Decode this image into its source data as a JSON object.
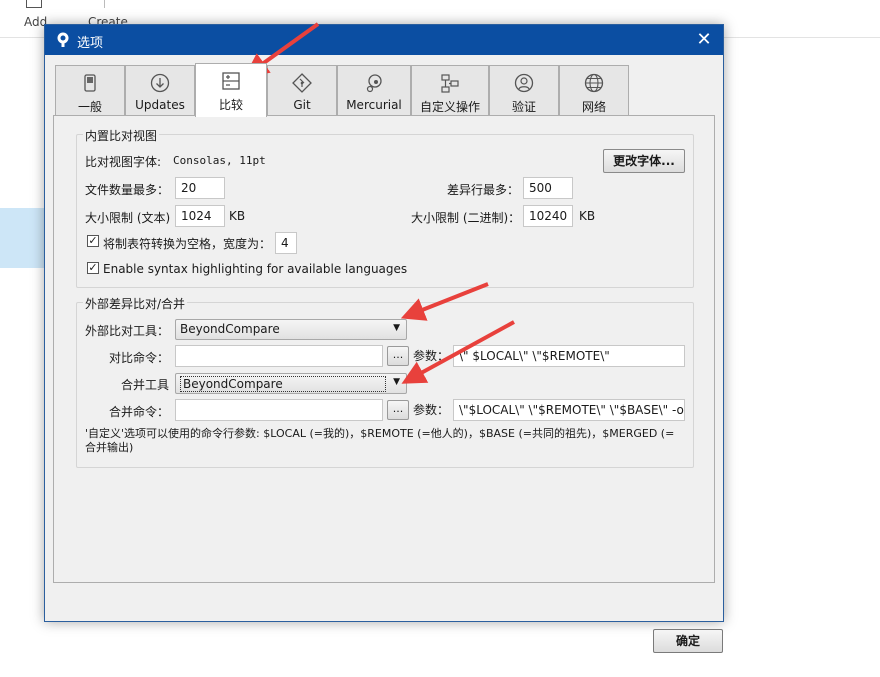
{
  "background": {
    "toolbar": {
      "add_label": "Add",
      "create_label": "Create"
    }
  },
  "dialog": {
    "title": "选项",
    "tabs": [
      {
        "label": "一般",
        "icon": "toggle-switch-icon"
      },
      {
        "label": "Updates",
        "icon": "download-arrow-icon"
      },
      {
        "label": "比较",
        "icon": "diff-compare-icon",
        "active": true
      },
      {
        "label": "Git",
        "icon": "git-diamond-icon"
      },
      {
        "label": "Mercurial",
        "icon": "mercurial-drop-icon"
      },
      {
        "label": "自定义操作",
        "icon": "custom-action-flow-icon"
      },
      {
        "label": "验证",
        "icon": "user-auth-icon"
      },
      {
        "label": "网络",
        "icon": "globe-icon"
      }
    ],
    "builtin_group": {
      "legend": "内置比对视图",
      "font_label": "比对视图字体:",
      "font_value": "Consolas, 11pt",
      "change_font_button": "更改字体...",
      "max_files_label": "文件数量最多：",
      "max_files_value": "20",
      "max_lines_label": "差异行最多：",
      "max_lines_value": "500",
      "size_limit_text_label": "大小限制 (文本)",
      "size_limit_text_value": "1024",
      "size_limit_binary_label": "大小限制 (二进制)：",
      "size_limit_binary_value": "10240",
      "kb_unit": "KB",
      "tabs_to_spaces_label": "将制表符转换为空格，宽度为：",
      "tabs_to_spaces_checked": true,
      "tab_width_value": "4",
      "syntax_highlight_label": "Enable syntax highlighting for available languages",
      "syntax_highlight_checked": true
    },
    "external_group": {
      "legend": "外部差异比对/合并",
      "diff_tool_label": "外部比对工具：",
      "diff_tool_value": "BeyondCompare",
      "diff_command_label": "对比命令：",
      "diff_command_value": "",
      "browse_label": "...",
      "diff_args_label": "参数：",
      "diff_args_value": "\\\" $LOCAL\\\" \\\"$REMOTE\\\"",
      "merge_tool_label": "合并工具",
      "merge_tool_value": "BeyondCompare",
      "merge_command_label": "合并命令：",
      "merge_command_value": "",
      "merge_args_label": "参数：",
      "merge_args_value": "\\\"$LOCAL\\\" \\\"$REMOTE\\\" \\\"$BASE\\\" -o",
      "help_text": "'自定义'选项可以使用的命令行参数: $LOCAL (=我的)，$REMOTE (=他人的)，$BASE (=共同的祖先)，$MERGED (=合并输出)"
    },
    "ok_button": "确定"
  },
  "colors": {
    "titlebar": "#0b4ea2",
    "annotation_arrow": "#e8413c",
    "selection_highlight": "#cde6f7"
  }
}
